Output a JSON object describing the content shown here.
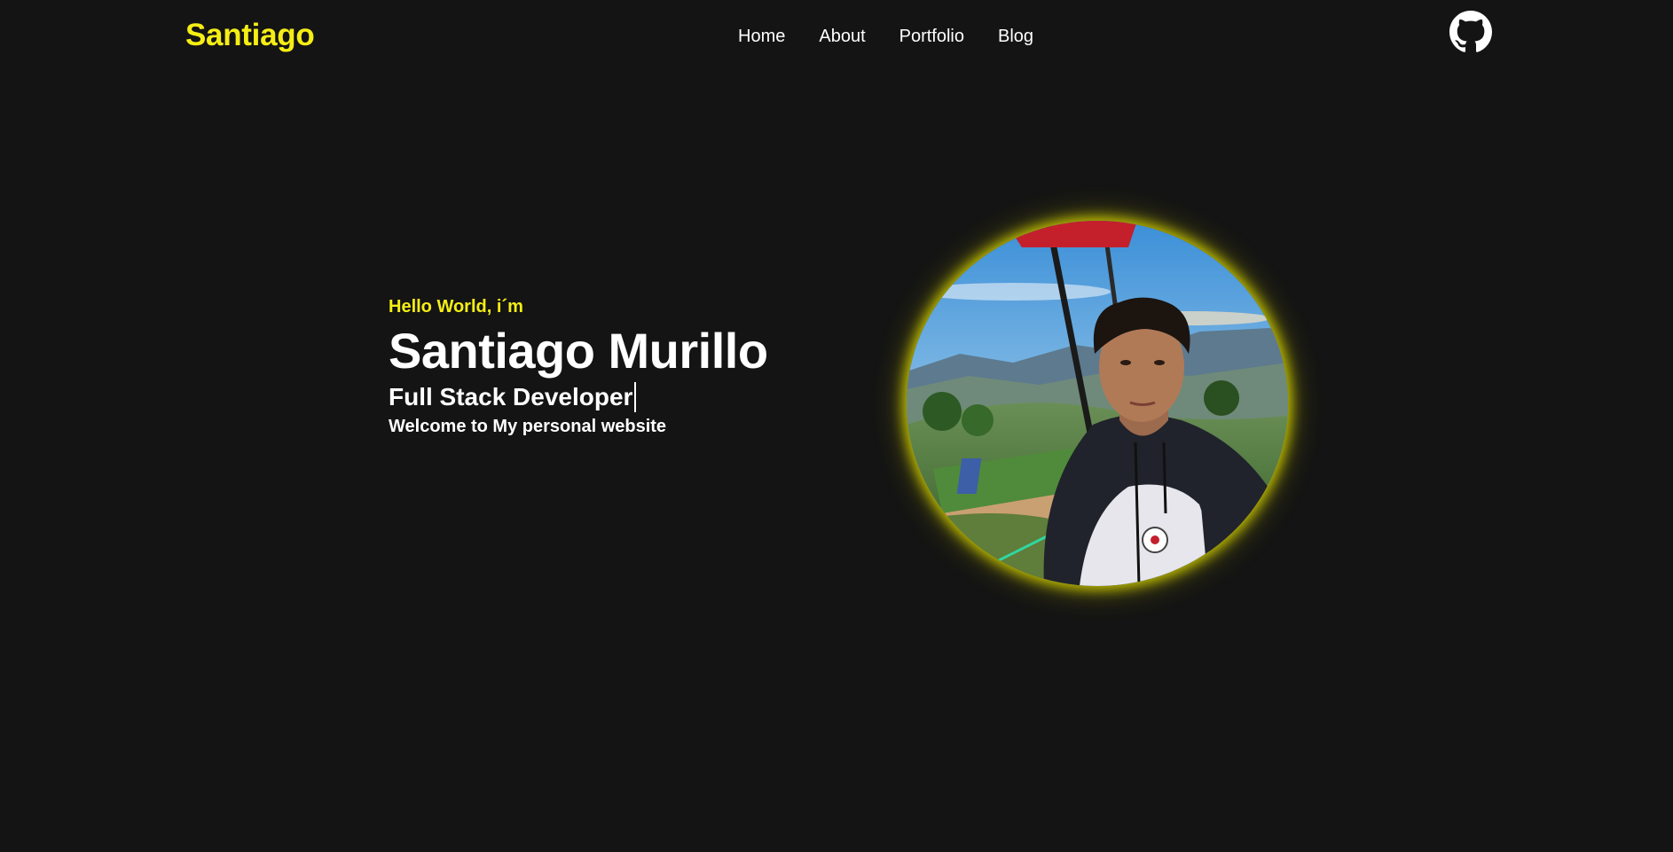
{
  "header": {
    "brand": "Santiago",
    "nav": [
      "Home",
      "About",
      "Portfolio",
      "Blog"
    ],
    "github_icon": "github-icon"
  },
  "hero": {
    "greeting": "Hello World, i´m",
    "name": "Santiago Murillo",
    "role": "Full Stack Developer",
    "welcome": "Welcome to My personal website"
  },
  "colors": {
    "background": "#141414",
    "accent": "#f5ee14",
    "text": "#ffffff"
  }
}
